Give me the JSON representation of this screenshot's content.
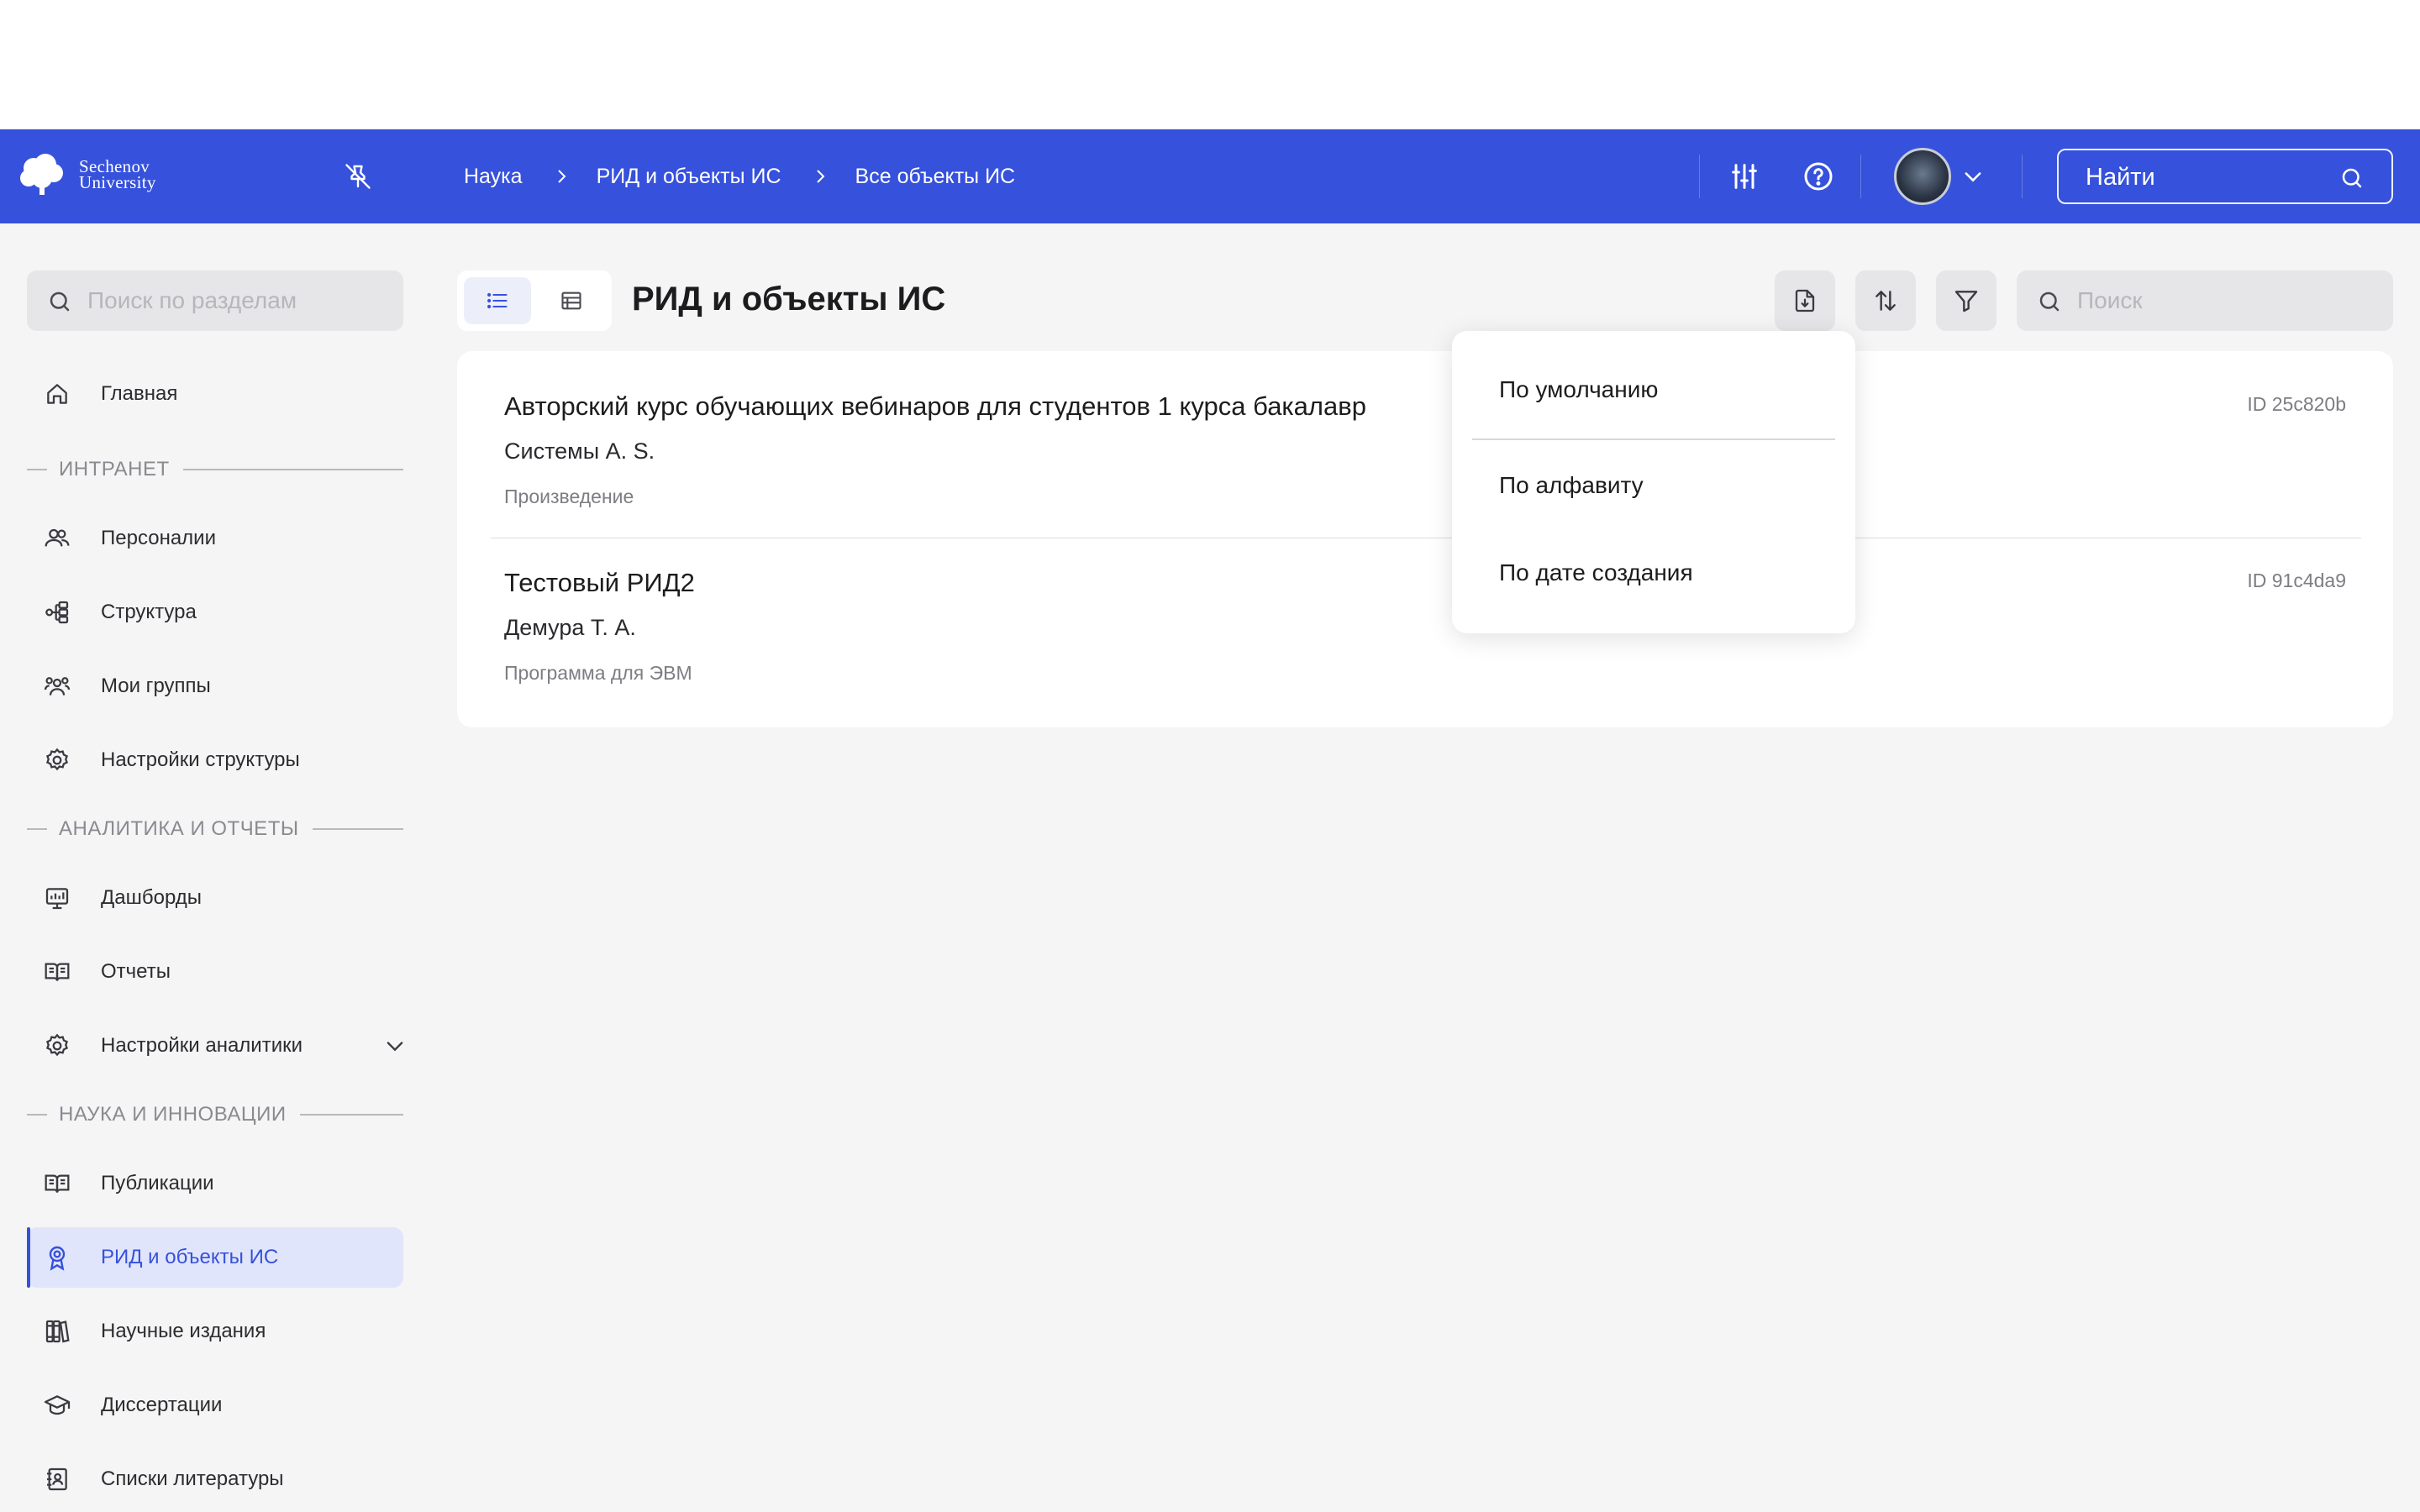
{
  "header": {
    "logo_line1": "Sechenov",
    "logo_line2": "University",
    "breadcrumb": [
      "Наука",
      "РИД и объекты ИС",
      "Все объекты ИС"
    ],
    "search_placeholder": "Найти"
  },
  "sidebar": {
    "search_placeholder": "Поиск по разделам",
    "home_label": "Главная",
    "sections": {
      "intranet": "ИНТРАНЕТ",
      "analytics": "АНАЛИТИКА И ОТЧЕТЫ",
      "science": "НАУКА И ИННОВАЦИИ"
    },
    "intranet_items": [
      "Персоналии",
      "Структура",
      "Мои группы",
      "Настройки структуры"
    ],
    "analytics_items": [
      "Дашборды",
      "Отчеты",
      "Настройки аналитики"
    ],
    "science_items": [
      "Публикации",
      "РИД и объекты ИС",
      "Научные издания",
      "Диссертации",
      "Списки литературы"
    ],
    "active_item": "РИД и объекты ИС"
  },
  "main": {
    "title": "РИД и объекты ИС",
    "search_placeholder": "Поиск",
    "records": [
      {
        "title": "Авторский курс обучающих вебинаров для студентов 1 курса бакалавр",
        "author": "Системы А. S.",
        "type": "Произведение",
        "id": "ID 25c820b"
      },
      {
        "title": "Тестовый РИД2",
        "author": "Демура Т. А.",
        "type": "Программа для ЭВМ",
        "id": "ID 91c4da9"
      }
    ]
  },
  "sort_menu": {
    "options": [
      "По умолчанию",
      "По алфавиту",
      "По дате создания"
    ]
  },
  "colors": {
    "brand": "#3651db",
    "background": "#f5f5f6",
    "active_bg": "#e1e5fb"
  },
  "icons": [
    "pin-off-icon",
    "sliders-icon",
    "help-icon",
    "chevron-down-icon",
    "search-icon",
    "home-icon",
    "users-icon",
    "structure-icon",
    "groups-icon",
    "gear-icon",
    "dashboard-icon",
    "book-icon",
    "award-icon",
    "books-icon",
    "graduation-cap-icon",
    "contacts-book-icon",
    "list-icon",
    "table-icon",
    "export-icon",
    "sort-icon",
    "filter-icon"
  ]
}
